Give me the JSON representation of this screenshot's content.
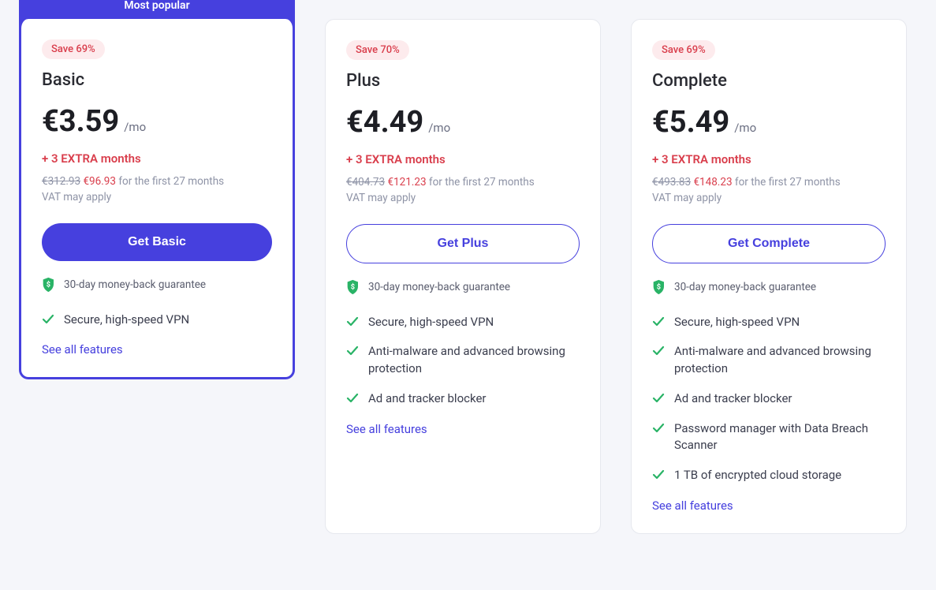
{
  "common": {
    "per_month": "/mo",
    "guarantee": "30-day money-back guarantee",
    "see_all": "See all features",
    "popular_label": "Most popular"
  },
  "plans": [
    {
      "featured": true,
      "save": "Save 69%",
      "name": "Basic",
      "price": "€3.59",
      "extra": "+ 3 EXTRA months",
      "strike": "€312.93",
      "deal": "€96.93",
      "period": "for the first 27 months",
      "vat": "VAT may apply",
      "cta": "Get Basic",
      "features": [
        "Secure, high-speed VPN"
      ]
    },
    {
      "featured": false,
      "save": "Save 70%",
      "name": "Plus",
      "price": "€4.49",
      "extra": "+ 3 EXTRA months",
      "strike": "€404.73",
      "deal": "€121.23",
      "period": "for the first 27 months",
      "vat": "VAT may apply",
      "cta": "Get Plus",
      "features": [
        "Secure, high-speed VPN",
        "Anti-malware and advanced browsing protection",
        "Ad and tracker blocker"
      ]
    },
    {
      "featured": false,
      "save": "Save 69%",
      "name": "Complete",
      "price": "€5.49",
      "extra": "+ 3 EXTRA months",
      "strike": "€493.83",
      "deal": "€148.23",
      "period": "for the first 27 months",
      "vat": "VAT may apply",
      "cta": "Get Complete",
      "features": [
        "Secure, high-speed VPN",
        "Anti-malware and advanced browsing protection",
        "Ad and tracker blocker",
        "Password manager with Data Breach Scanner",
        "1 TB of encrypted cloud storage"
      ]
    }
  ]
}
